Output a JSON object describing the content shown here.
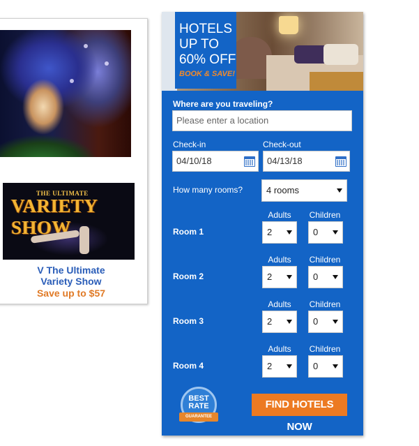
{
  "promo": {
    "title_line1": "V The Ultimate",
    "title_line2": "Variety Show",
    "save": "Save up to $57",
    "banner_small": "THE ULTIMATE",
    "banner_large": "VARIETY SHOW"
  },
  "hotel": {
    "title_line1": "HOTELS",
    "title_line2": "UP TO",
    "title_line3": "60% OFF",
    "cta": "BOOK & SAVE!",
    "where_label": "Where are you traveling?",
    "location_placeholder": "Please enter a location",
    "checkin_label": "Check-in",
    "checkout_label": "Check-out",
    "checkin_value": "04/10/18",
    "checkout_value": "04/13/18",
    "rooms_label": "How many rooms?",
    "rooms_value": "4 rooms",
    "adults_label": "Adults",
    "children_label": "Children",
    "rooms": [
      {
        "label": "Room 1",
        "adults": "2",
        "children": "0"
      },
      {
        "label": "Room 2",
        "adults": "2",
        "children": "0"
      },
      {
        "label": "Room 3",
        "adults": "2",
        "children": "0"
      },
      {
        "label": "Room 4",
        "adults": "2",
        "children": "0"
      }
    ],
    "badge_line1": "BEST",
    "badge_line2": "RATE",
    "badge_ribbon": "GUARANTEE",
    "find_button": "FIND HOTELS NOW"
  },
  "colors": {
    "widget_blue": "#1364c6",
    "orange": "#ec7a22",
    "promo_link": "#2a5db8"
  }
}
